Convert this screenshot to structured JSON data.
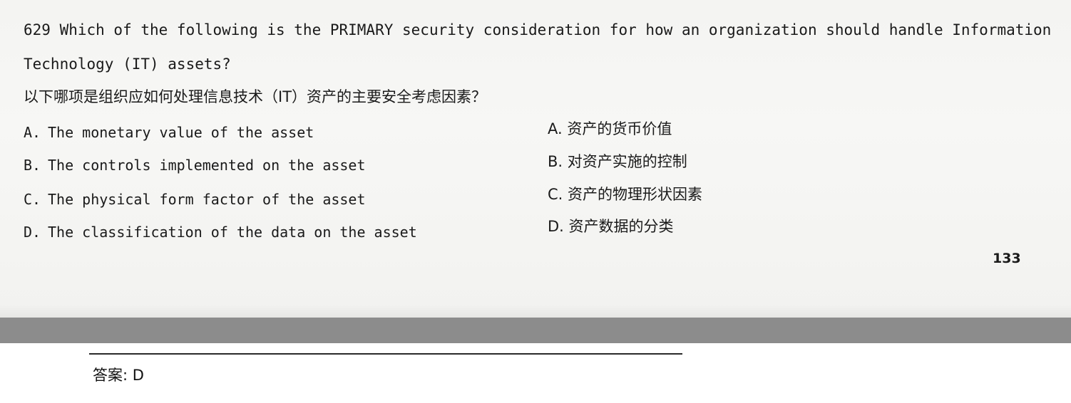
{
  "question": {
    "line1": "629 Which of the following is the PRIMARY security consideration for how an organization should handle Information",
    "line2": "Technology (IT) assets?",
    "zh": "以下哪项是组织应如何处理信息技术（IT）资产的主要安全考虑因素？"
  },
  "options_en": [
    {
      "letter": "A.",
      "text": "The monetary value of the asset"
    },
    {
      "letter": "B.",
      "text": "The controls implemented on the asset"
    },
    {
      "letter": "C.",
      "text": "The physical form factor of the asset"
    },
    {
      "letter": "D.",
      "text": "The classification of the data on the asset"
    }
  ],
  "options_zh": [
    "A. 资产的货币价值",
    "B. 对资产实施的控制",
    "C. 资产的物理形状因素",
    "D. 资产数据的分类"
  ],
  "page_number": "133",
  "answer": "答案: D"
}
